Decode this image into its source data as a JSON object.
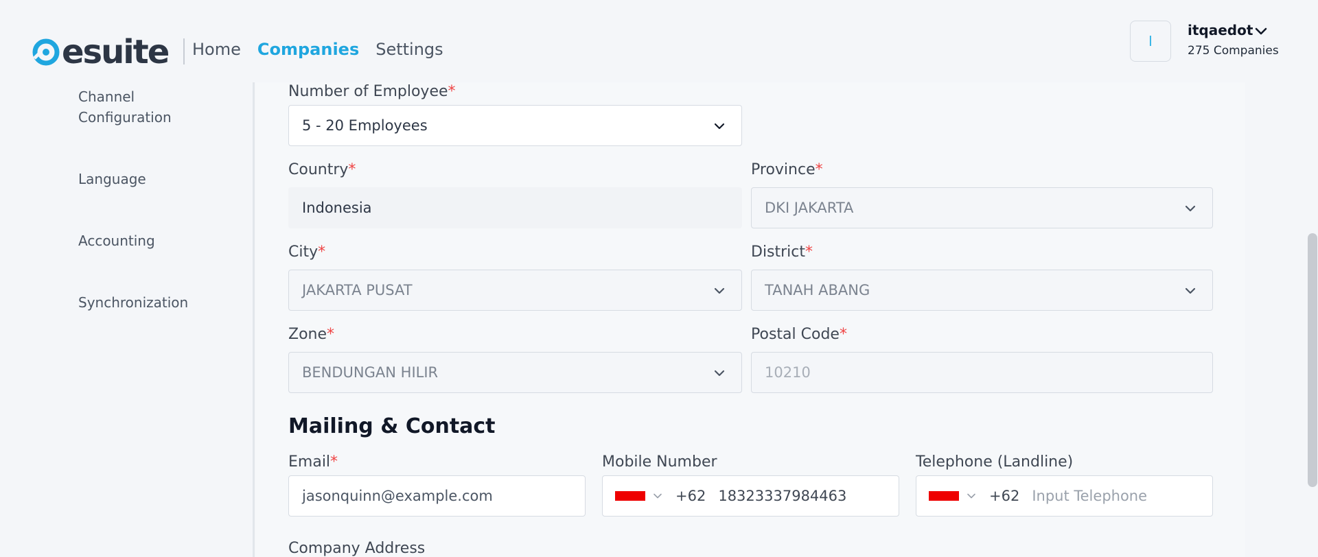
{
  "header": {
    "logo_text": "esuite",
    "nav": [
      {
        "label": "Home",
        "active": false
      },
      {
        "label": "Companies",
        "active": true
      },
      {
        "label": "Settings",
        "active": false
      }
    ],
    "avatar_initial": "I",
    "user_name": "itqaedot",
    "user_companies": "275 Companies"
  },
  "sidebar": {
    "items": [
      {
        "label": "Channel Configuration"
      },
      {
        "label": "Language"
      },
      {
        "label": "Accounting"
      },
      {
        "label": "Synchronization"
      }
    ]
  },
  "form": {
    "employees": {
      "label": "Number of Employee",
      "value": "5 - 20 Employees"
    },
    "country": {
      "label": "Country",
      "value": "Indonesia"
    },
    "province": {
      "label": "Province",
      "value": "DKI JAKARTA"
    },
    "city": {
      "label": "City",
      "value": "JAKARTA PUSAT"
    },
    "district": {
      "label": "District",
      "value": "TANAH ABANG"
    },
    "zone": {
      "label": "Zone",
      "value": "BENDUNGAN HILIR"
    },
    "postal": {
      "label": "Postal Code",
      "value": "10210"
    },
    "required_mark": "*"
  },
  "contact": {
    "section_title": "Mailing & Contact",
    "email": {
      "label": "Email",
      "value": "jasonquinn@example.com"
    },
    "mobile": {
      "label": "Mobile Number",
      "dial_code": "+62",
      "value": "18323337984463"
    },
    "telephone": {
      "label": "Telephone (Landline)",
      "dial_code": "+62",
      "placeholder": "Input Telephone"
    },
    "address_label": "Company Address"
  },
  "colors": {
    "accent": "#1fa6df",
    "required": "#ef4444",
    "flag_red": "#ee0000"
  }
}
